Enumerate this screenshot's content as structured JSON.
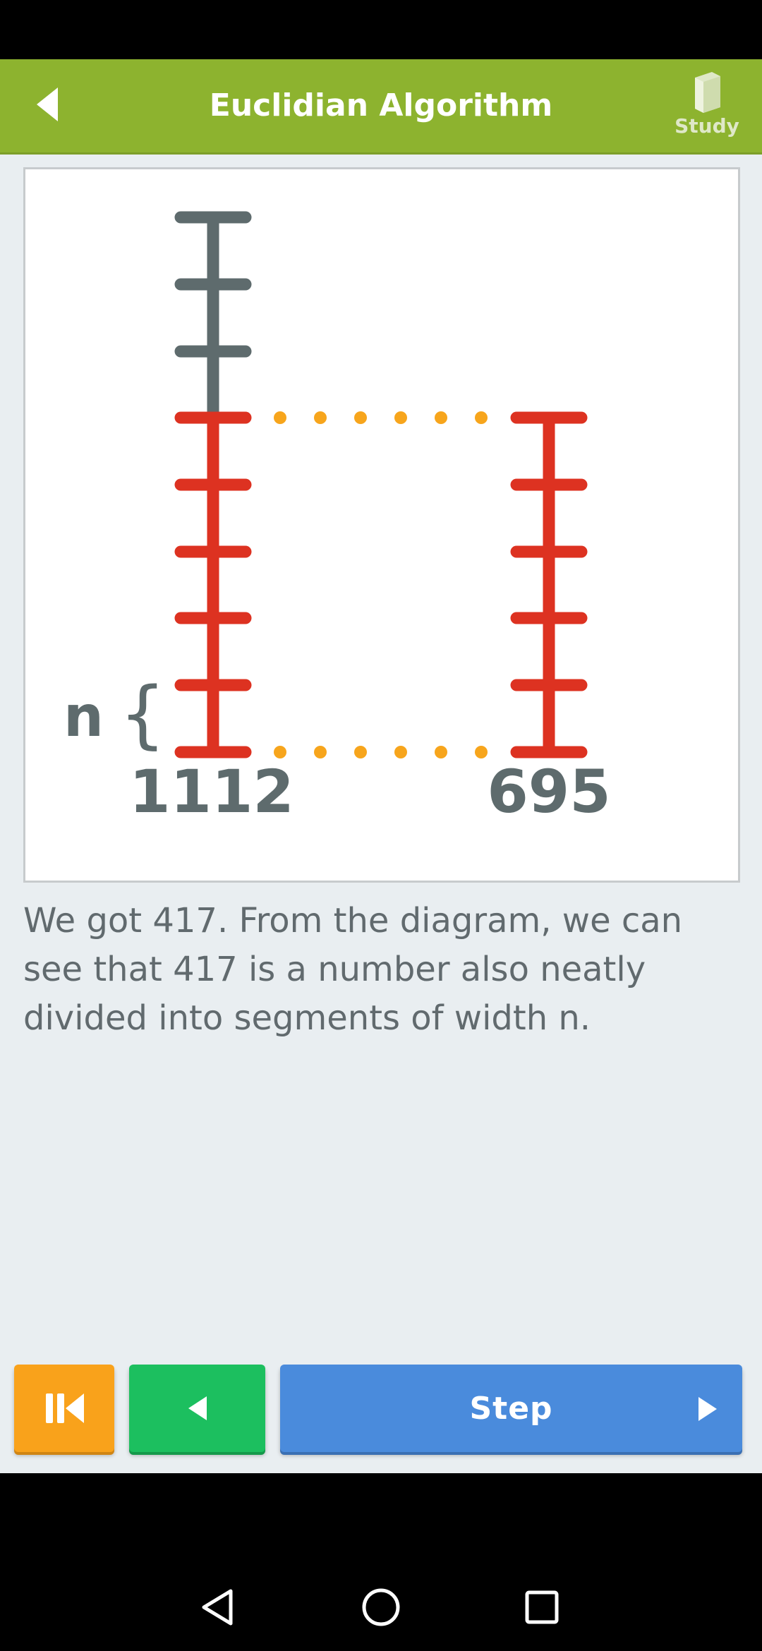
{
  "header": {
    "title": "Euclidian Algorithm",
    "study_label": "Study",
    "back_icon": "back-arrow-icon",
    "study_icon": "book-icon"
  },
  "diagram": {
    "label_left": "1112",
    "label_right": "695",
    "segment_label": "n",
    "brace": "{",
    "left_bar": {
      "gray_segments": 3,
      "red_segments": 5
    },
    "right_bar": {
      "red_segments": 5
    },
    "dots_per_row": 6,
    "colors": {
      "gray": "#5e6b6d",
      "red": "#dd3221",
      "dot": "#f7a51c",
      "label": "#5e6b6d"
    }
  },
  "caption": "We got 417. From the diagram, we can see that 417 is a number also neatly divided into segments of width n.",
  "controls": {
    "rewind_icon": "skip-to-start-icon",
    "prev_icon": "play-left-icon",
    "step_label": "Step",
    "step_icon": "play-right-icon",
    "colors": {
      "rewind": "#f9a21b",
      "prev": "#1cbf5f",
      "step": "#4a8bdc"
    }
  },
  "colors": {
    "app_bar": "#8db32f",
    "background": "#e9eef1",
    "caption_text": "#616a6e"
  },
  "system_nav": {
    "back_icon": "nav-back-icon",
    "home_icon": "nav-home-icon",
    "recents_icon": "nav-recents-icon"
  }
}
